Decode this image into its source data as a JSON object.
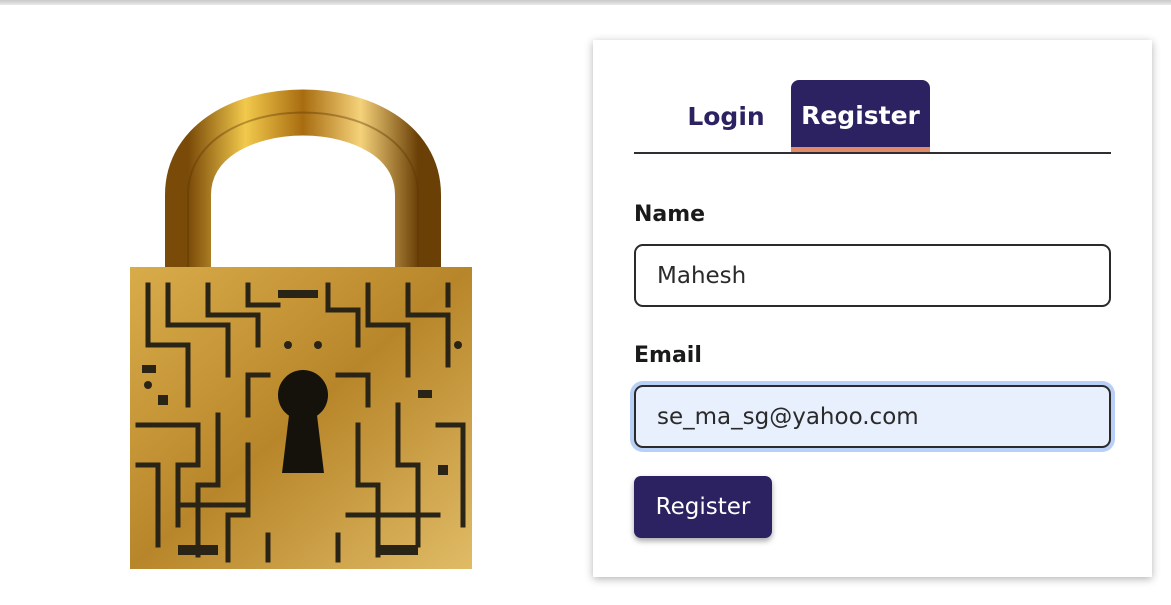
{
  "tabs": [
    {
      "label": "Login",
      "active": false
    },
    {
      "label": "Register",
      "active": true
    }
  ],
  "form": {
    "name_label": "Name",
    "name_value": "Mahesh",
    "email_label": "Email",
    "email_value": "se_ma_sg@yahoo.com",
    "submit_label": "Register"
  },
  "colors": {
    "primary": "#2d2261",
    "tab_underline": "#e08a6a",
    "focus_fill": "#e8f0fe",
    "lock_gold": "#c8962a"
  },
  "hero_image": {
    "icon": "padlock-circuit-icon"
  }
}
